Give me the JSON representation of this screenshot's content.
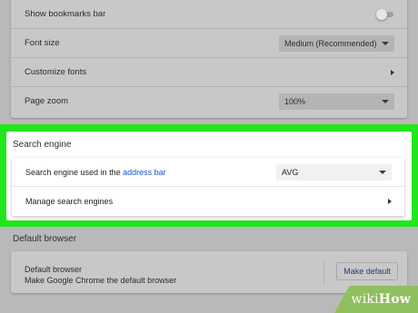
{
  "appearance": {
    "show_bookmarks_bar": {
      "label": "Show bookmarks bar",
      "on": false
    },
    "font_size": {
      "label": "Font size",
      "value": "Medium (Recommended)"
    },
    "customize_fonts": {
      "label": "Customize fonts"
    },
    "page_zoom": {
      "label": "Page zoom",
      "value": "100%"
    }
  },
  "search_engine": {
    "title": "Search engine",
    "used_in_label_prefix": "Search engine used in the",
    "address_bar_link": "address bar",
    "value": "AVG",
    "manage_label": "Manage search engines"
  },
  "default_browser": {
    "title": "Default browser",
    "label": "Default browser",
    "description": "Make Google Chrome the default browser",
    "button": "Make default"
  },
  "watermark": {
    "part1": "wiki",
    "part2": "How"
  },
  "colors": {
    "highlight": "#22e61c",
    "link": "#1a56c4",
    "watermark_bg": "#8fbf5f"
  }
}
